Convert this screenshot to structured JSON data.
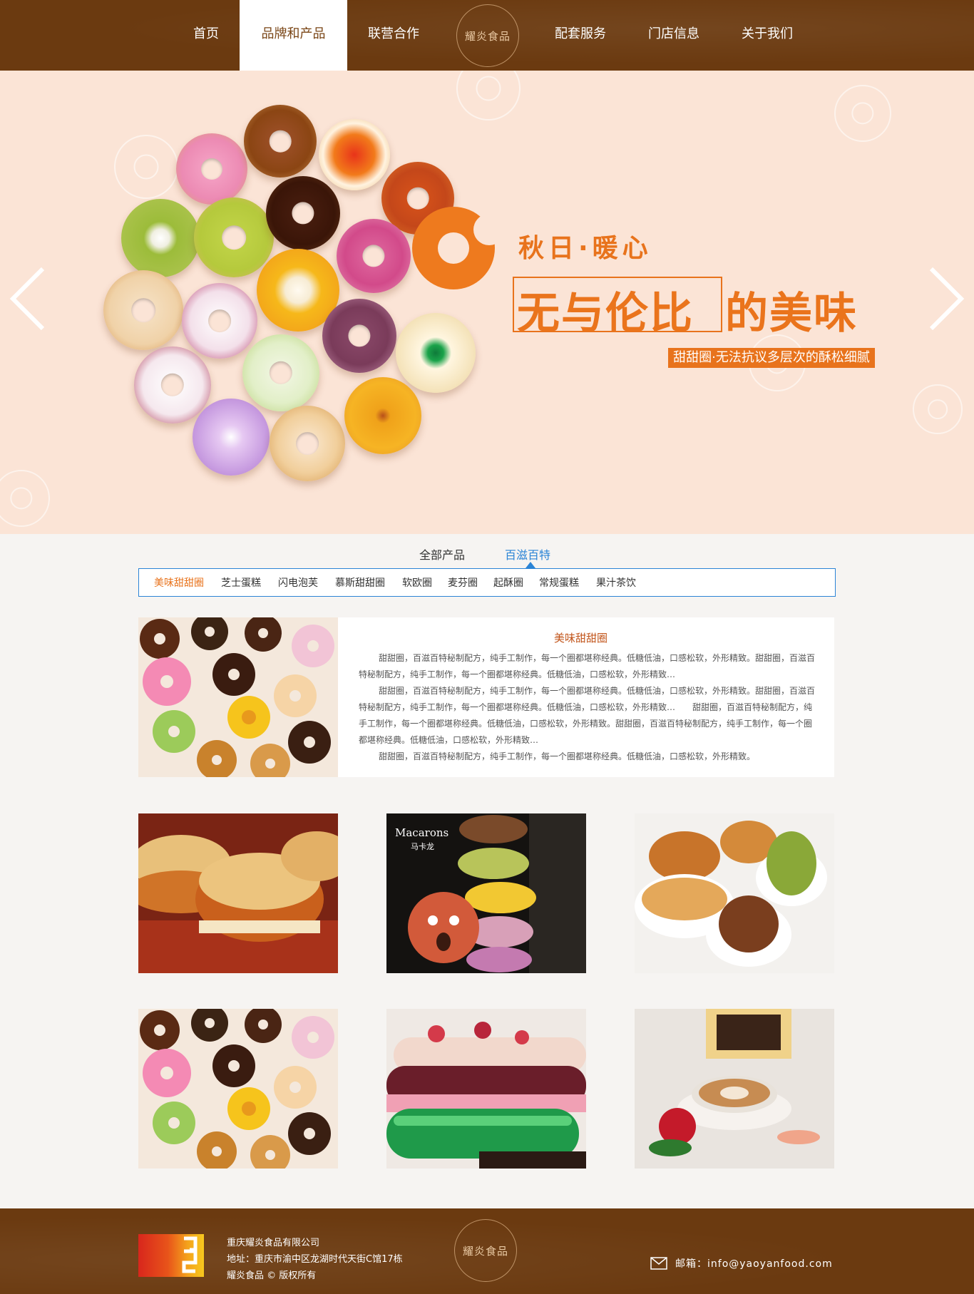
{
  "nav": {
    "items": [
      "首页",
      "品牌和产品",
      "联营合作",
      "配套服务",
      "门店信息",
      "关于我们"
    ],
    "active_index": 1,
    "logo_text": "耀炎食品"
  },
  "hero": {
    "subtitle": "秋日·暖心",
    "title_boxed": "无与伦比",
    "title_rest": "的美味",
    "tagline": "甜甜圈·无法抗议多层次的酥松细腻",
    "prev_icon": "chevron-left-icon",
    "next_icon": "chevron-right-icon"
  },
  "tabs": {
    "items": [
      "全部产品",
      "百滋百特"
    ],
    "active_index": 1,
    "sub_items": [
      "美味甜甜圈",
      "芝士蛋糕",
      "闪电泡芙",
      "慕斯甜甜圈",
      "软欧圈",
      "麦芬圈",
      "起酥圈",
      "常规蛋糕",
      "果汁茶饮"
    ],
    "sub_active_index": 0
  },
  "feature": {
    "title": "美味甜甜圈",
    "paragraphs": [
      "甜甜圈，百滋百特秘制配方，纯手工制作，每一个圈都堪称经典。低糖低油，口感松软，外形精致。甜甜圈，百滋百特秘制配方，纯手工制作，每一个圈都堪称经典。低糖低油，口感松软，外形精致…",
      "甜甜圈，百滋百特秘制配方，纯手工制作，每一个圈都堪称经典。低糖低油，口感松软，外形精致。甜甜圈，百滋百特秘制配方，纯手工制作，每一个圈都堪称经典。低糖低油，口感松软，外形精致…　　甜甜圈，百滋百特秘制配方，纯手工制作，每一个圈都堪称经典。低糖低油，口感松软，外形精致。甜甜圈，百滋百特秘制配方，纯手工制作，每一个圈都堪称经典。低糖低油，口感松软，外形精致…",
      "甜甜圈，百滋百特秘制配方，纯手工制作，每一个圈都堪称经典。低糖低油，口感松软，外形精致。"
    ]
  },
  "grid": {
    "macaron_label_en": "Macarons",
    "macaron_label_cn": "马卡龙"
  },
  "footer": {
    "company": "重庆耀炎食品有限公司",
    "address": "地址：重庆市渝中区龙湖时代天街C馆17栋",
    "copyright": "耀炎食品 © 版权所有",
    "logo_text": "耀炎食品",
    "email_label": "邮箱：info@yaoyanfood.com",
    "mail_icon": "mail-icon"
  },
  "colors": {
    "brand_brown": "#6b3a10",
    "accent_orange": "#e8731c",
    "tab_blue": "#2b84d6",
    "hero_bg": "#fbe4d6"
  }
}
